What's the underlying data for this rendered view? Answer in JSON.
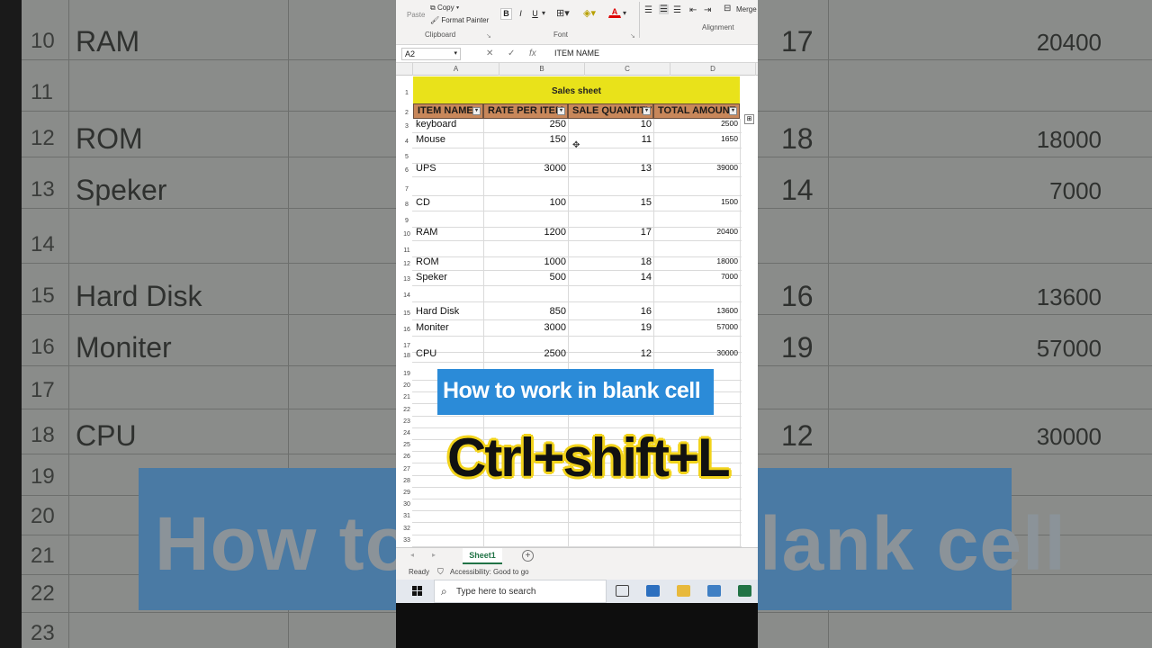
{
  "background_zoom": {
    "rows": [
      {
        "row": "10",
        "name": "RAM",
        "qty": "17",
        "total": "20400"
      },
      {
        "row": "11",
        "name": "",
        "qty": "",
        "total": ""
      },
      {
        "row": "12",
        "name": "ROM",
        "qty": "18",
        "total": "18000"
      },
      {
        "row": "13",
        "name": "Speker",
        "qty": "14",
        "total": "7000"
      },
      {
        "row": "14",
        "name": "",
        "qty": "",
        "total": ""
      },
      {
        "row": "15",
        "name": "Hard Disk",
        "qty": "16",
        "total": "13600"
      },
      {
        "row": "16",
        "name": "Moniter",
        "qty": "19",
        "total": "57000"
      },
      {
        "row": "17",
        "name": "",
        "qty": "",
        "total": ""
      },
      {
        "row": "18",
        "name": "CPU",
        "qty": "12",
        "total": "30000"
      },
      {
        "row": "19",
        "name": "",
        "qty": "",
        "total": ""
      },
      {
        "row": "20",
        "name": "",
        "qty": "",
        "total": ""
      },
      {
        "row": "21",
        "name": "",
        "qty": "",
        "total": ""
      },
      {
        "row": "22",
        "name": "",
        "qty": "",
        "total": ""
      },
      {
        "row": "23",
        "name": "",
        "qty": "",
        "total": ""
      }
    ],
    "banner_text": "How to w          blank cell"
  },
  "ribbon": {
    "paste": "Paste",
    "copy": "Copy",
    "format_painter": "Format Painter",
    "clipboard_group": "Clipboard",
    "bold": "B",
    "italic": "I",
    "underline": "U",
    "font_color": "A",
    "font_group": "Font",
    "alignment_group": "Alignment",
    "merge": "Merge"
  },
  "formula_bar": {
    "name_box": "A2",
    "formula": "ITEM NAME"
  },
  "columns": [
    "A",
    "B",
    "C",
    "D"
  ],
  "sheet": {
    "title": "Sales sheet",
    "headers": [
      "ITEM NAME",
      "RATE PER ITEM",
      "SALE QUANTITY",
      "TOTAL AMOUNT"
    ],
    "rows": [
      {
        "item": "keyboard",
        "rate": "250",
        "qty": "10",
        "total": "2500"
      },
      {
        "item": "Mouse",
        "rate": "150",
        "qty": "11",
        "total": "1650"
      },
      {
        "item": "",
        "rate": "",
        "qty": "",
        "total": ""
      },
      {
        "item": "UPS",
        "rate": "3000",
        "qty": "13",
        "total": "39000"
      },
      {
        "item": "",
        "rate": "",
        "qty": "",
        "total": ""
      },
      {
        "item": "CD",
        "rate": "100",
        "qty": "15",
        "total": "1500"
      },
      {
        "item": "",
        "rate": "",
        "qty": "",
        "total": ""
      },
      {
        "item": "RAM",
        "rate": "1200",
        "qty": "17",
        "total": "20400"
      },
      {
        "item": "",
        "rate": "",
        "qty": "",
        "total": ""
      },
      {
        "item": "ROM",
        "rate": "1000",
        "qty": "18",
        "total": "18000"
      },
      {
        "item": "Speker",
        "rate": "500",
        "qty": "14",
        "total": "7000"
      },
      {
        "item": "",
        "rate": "",
        "qty": "",
        "total": ""
      },
      {
        "item": "Hard Disk",
        "rate": "850",
        "qty": "16",
        "total": "13600"
      },
      {
        "item": "Moniter",
        "rate": "3000",
        "qty": "19",
        "total": "57000"
      },
      {
        "item": "",
        "rate": "",
        "qty": "",
        "total": ""
      },
      {
        "item": "CPU",
        "rate": "2500",
        "qty": "12",
        "total": "30000"
      }
    ],
    "row_numbers": [
      "1",
      "2",
      "3",
      "4",
      "5",
      "6",
      "7",
      "8",
      "9",
      "10",
      "11",
      "12",
      "13",
      "14",
      "15",
      "16",
      "17",
      "18",
      "19",
      "20",
      "21",
      "22",
      "23",
      "24",
      "25",
      "26",
      "27",
      "28",
      "29",
      "30",
      "31",
      "32",
      "33"
    ]
  },
  "sheet_tab": "Sheet1",
  "status": {
    "ready": "Ready",
    "accessibility": "Accessibility: Good to go"
  },
  "taskbar": {
    "search_placeholder": "Type here to search"
  },
  "overlay": {
    "caption": "How to work in blank cell",
    "shortcut": "Ctrl+shift+L"
  },
  "colors": {
    "title_fill": "#e9e21a",
    "header_fill": "#c8875a",
    "caption_bg": "#2b8bd8",
    "shortcut_outline": "#f2d31b",
    "excel_green": "#217346"
  }
}
